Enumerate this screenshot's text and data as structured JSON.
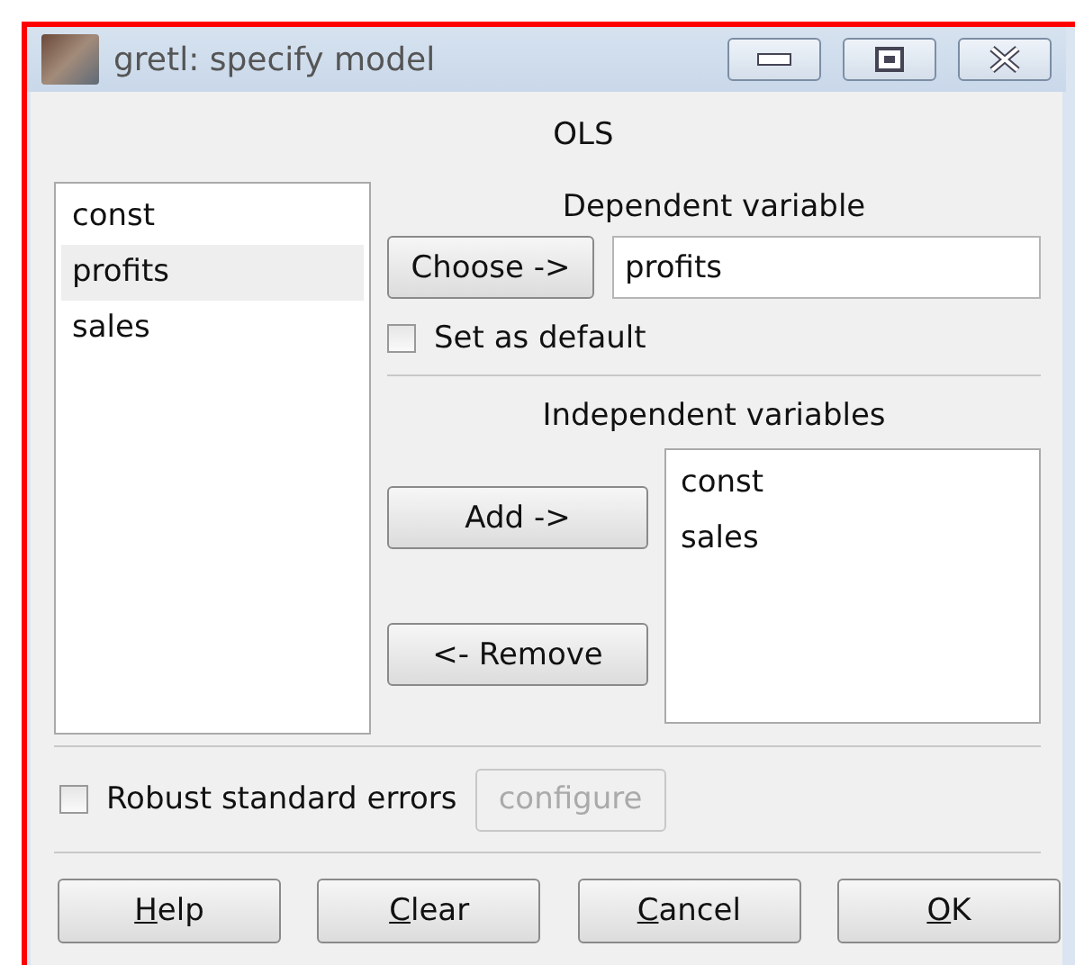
{
  "window": {
    "title": "gretl: specify model"
  },
  "model_label": "OLS",
  "variables": [
    {
      "name": "const",
      "selected": false
    },
    {
      "name": "profits",
      "selected": true
    },
    {
      "name": "sales",
      "selected": false
    }
  ],
  "dependent": {
    "heading": "Dependent variable",
    "choose_button": "Choose ->",
    "value": "profits",
    "set_default": {
      "label": "Set as default",
      "checked": false
    }
  },
  "independent": {
    "heading": "Independent variables",
    "add_button": "Add ->",
    "remove_button": "<- Remove",
    "items": [
      "const",
      "sales"
    ]
  },
  "robust": {
    "label": "Robust standard errors",
    "checked": false,
    "configure": {
      "label": "configure",
      "disabled": true
    }
  },
  "buttons": [
    {
      "mnemonic": "H",
      "rest": "elp"
    },
    {
      "mnemonic": "C",
      "rest": "lear"
    },
    {
      "mnemonic": "C",
      "rest": "ancel"
    },
    {
      "mnemonic": "O",
      "rest": "K"
    }
  ]
}
